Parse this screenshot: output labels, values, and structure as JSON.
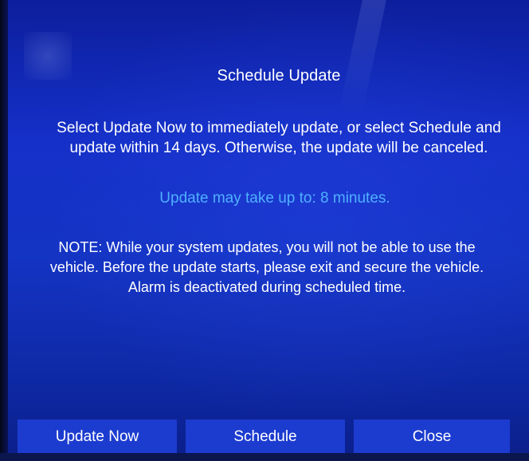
{
  "dialog": {
    "title": "Schedule Update",
    "message_line1": "Select Update Now to immediately update, or select Schedule and",
    "message_line2": "update within 14 days. Otherwise, the update will be canceled.",
    "duration": "Update may take up to: 8 minutes.",
    "note_line1": "NOTE: While your system updates, you will not be able to use the",
    "note_line2": "vehicle. Before the update starts, please exit and secure the vehicle.",
    "note_line3": "Alarm is deactivated during scheduled time."
  },
  "buttons": {
    "update_now": "Update Now",
    "schedule": "Schedule",
    "close": "Close"
  },
  "colors": {
    "background": "#1530c8",
    "button": "#1c3cd0",
    "text": "#ffffff",
    "accent": "#4fb0ff"
  }
}
